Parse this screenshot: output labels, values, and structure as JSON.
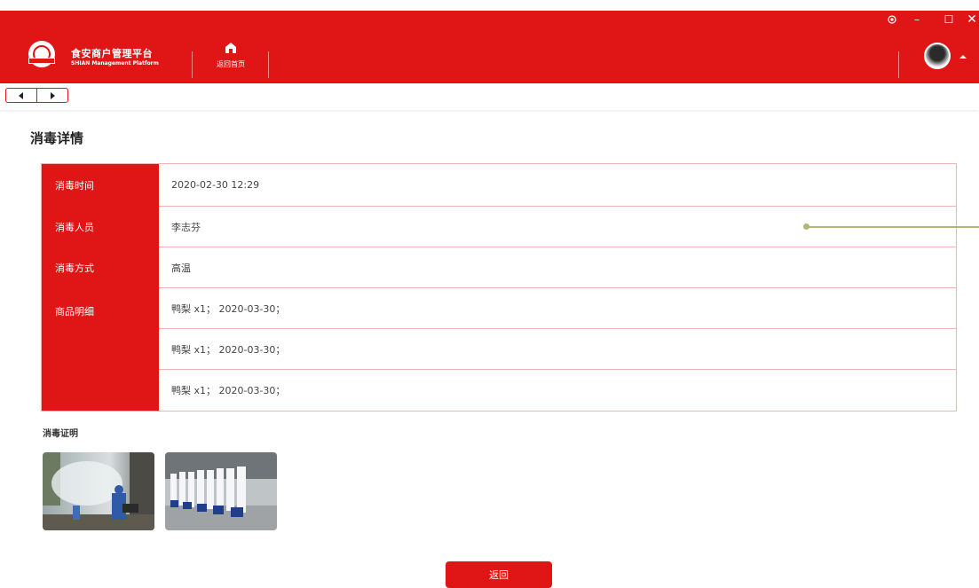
{
  "header": {
    "brand_title": "食安商户管理平台",
    "brand_subtitle": "SHIAN Management Platform",
    "home_label": "返回首页",
    "bg_color": "#e01616"
  },
  "window_controls": {
    "settings_icon": "settings-icon",
    "minimize": "–",
    "maximize": "☐",
    "close": "✕"
  },
  "page": {
    "title": "消毒详情"
  },
  "detail": {
    "rows": [
      {
        "label": "消毒时间",
        "value": "2020-02-30 12:29"
      },
      {
        "label": "消毒人员",
        "value": "李志芬"
      },
      {
        "label": "消毒方式",
        "value": "高温"
      }
    ],
    "goods_label": "商品明细",
    "goods": [
      "鸭梨 x1； 2020-03-30；",
      "鸭梨 x1； 2020-03-30；",
      "鸭梨 x1； 2020-03-30；"
    ]
  },
  "proof": {
    "title": "消毒证明",
    "images": [
      "disinfection-spraying-photo",
      "disinfection-team-photo"
    ]
  },
  "actions": {
    "back_label": "返回"
  }
}
